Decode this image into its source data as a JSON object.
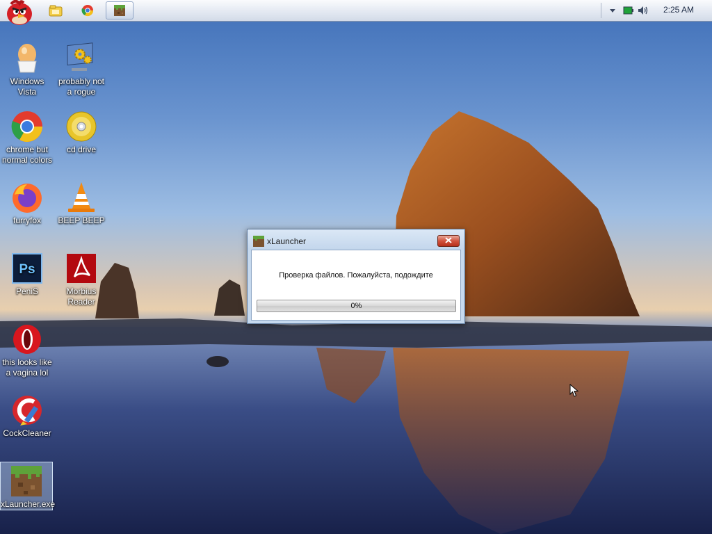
{
  "taskbar": {
    "start_icon": "angry-bird-icon",
    "pinned": [
      {
        "icon": "explorer-folder-icon"
      },
      {
        "icon": "chrome-icon"
      },
      {
        "icon": "minecraft-block-icon",
        "active": true
      }
    ],
    "tray": {
      "icons": [
        "show-hidden-arrow-icon",
        "battery-icon",
        "volume-icon"
      ],
      "time": "2:25 AM"
    }
  },
  "desktop": {
    "icons": [
      {
        "label": "Windows Vista",
        "icon": "egg-icon"
      },
      {
        "label": "probably not a rogue",
        "icon": "monitor-gears-icon"
      },
      {
        "label": "chrome but normal colors",
        "icon": "chrome-icon"
      },
      {
        "label": "cd drive",
        "icon": "cd-disc-icon"
      },
      {
        "label": "furryfox",
        "icon": "firefox-icon"
      },
      {
        "label": "BEEP BEEP",
        "icon": "traffic-cone-icon"
      },
      {
        "label": "PeniS",
        "icon": "photoshop-icon"
      },
      {
        "label": "Morbius Reader",
        "icon": "pdf-reader-icon"
      },
      {
        "label": "this looks like a vagina lol",
        "icon": "opera-icon"
      },
      {
        "label": "CockCleaner",
        "icon": "ccleaner-icon"
      },
      {
        "label": "xLauncher.exe",
        "icon": "minecraft-block-icon",
        "selected": true
      }
    ]
  },
  "dialog": {
    "title": "xLauncher",
    "message": "Проверка файлов. Пожалуйста, подождите",
    "progress_text": "0%",
    "progress_value": 0
  },
  "colors": {
    "taskbar": "#e4e9f2",
    "dialog_frame": "#c6d9ee",
    "close_button": "#d1533e"
  }
}
